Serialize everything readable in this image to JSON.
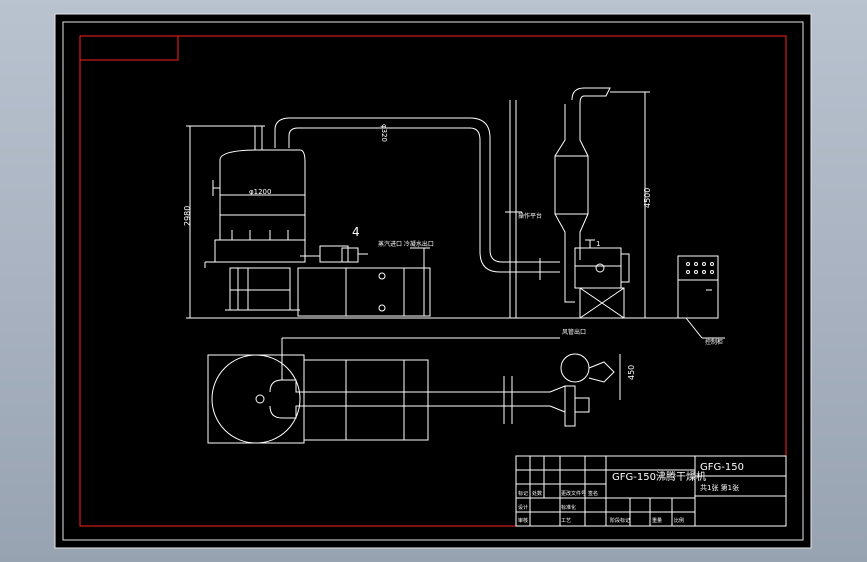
{
  "drawing": {
    "model_code": "GFG-150",
    "title_cn": "GFG-150沸腾干燥机",
    "title_meta": "共1张 第1张"
  },
  "dimensions": {
    "top_duct": "φ320",
    "tank": "φ1200",
    "height_left": "2980",
    "height_right": "4500",
    "plan_offset": "450"
  },
  "annotations": {
    "balloon": "4",
    "heater_note": "蒸汽进口  冷凝水出口",
    "platform_note": "操作平台",
    "fan_tag": "1",
    "cabinet_tag": "控制柜",
    "plan_tag": "风管出口"
  },
  "title_block": {
    "rows": [
      "标记",
      "处数",
      "分区",
      "更改文件号",
      "签名",
      "年月日"
    ],
    "roles": [
      "设计",
      "标准化",
      "审核",
      "工艺",
      "批准"
    ],
    "stage": "阶段标记",
    "weight": "重量",
    "scale": "比例"
  },
  "colors": {
    "frame": "#ff2020",
    "lines": "#ffffff",
    "background": "#000000"
  }
}
